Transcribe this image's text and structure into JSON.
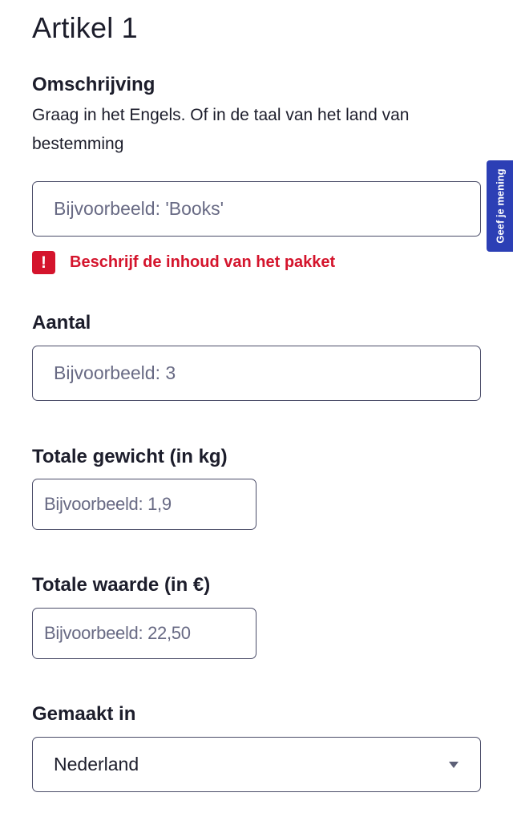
{
  "article": {
    "title": "Artikel 1"
  },
  "description": {
    "label": "Omschrijving",
    "help": "Graag in het Engels. Of in de taal van het land van bestemming",
    "placeholder": "Bijvoorbeeld: 'Books'",
    "value": "",
    "error": "Beschrijf de inhoud van het pakket"
  },
  "quantity": {
    "label": "Aantal",
    "placeholder": "Bijvoorbeeld: 3",
    "value": ""
  },
  "weight": {
    "label": "Totale gewicht (in kg)",
    "placeholder": "Bijvoorbeeld: 1,9",
    "value": ""
  },
  "value_field": {
    "label": "Totale waarde (in €)",
    "placeholder": "Bijvoorbeeld: 22,50",
    "value": ""
  },
  "origin": {
    "label": "Gemaakt in",
    "selected": "Nederland"
  },
  "feedback": {
    "label": "Geef je mening"
  },
  "icons": {
    "error": "exclamation-icon",
    "select": "chevron-down-icon"
  },
  "colors": {
    "error": "#d4142c",
    "feedback_tab": "#2c3fb5",
    "text": "#1c1d2b",
    "border": "#4a4c68"
  }
}
